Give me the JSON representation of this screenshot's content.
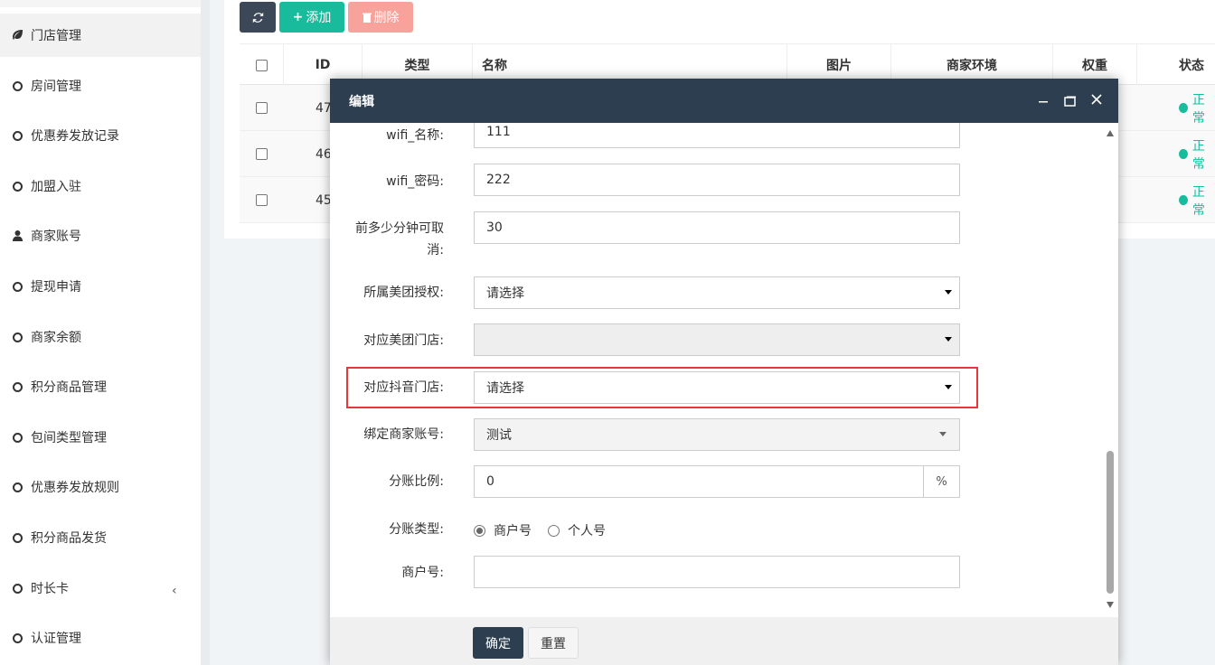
{
  "sidebar": {
    "items": [
      {
        "label": "门店管理",
        "icon": "leaf-icon"
      },
      {
        "label": "房间管理",
        "icon": "circle-icon"
      },
      {
        "label": "优惠券发放记录",
        "icon": "circle-icon"
      },
      {
        "label": "加盟入驻",
        "icon": "circle-icon"
      },
      {
        "label": "商家账号",
        "icon": "user-icon"
      },
      {
        "label": "提现申请",
        "icon": "circle-icon"
      },
      {
        "label": "商家余额",
        "icon": "circle-icon"
      },
      {
        "label": "积分商品管理",
        "icon": "circle-icon"
      },
      {
        "label": "包间类型管理",
        "icon": "circle-icon"
      },
      {
        "label": "优惠券发放规则",
        "icon": "circle-icon"
      },
      {
        "label": "积分商品发货",
        "icon": "circle-icon"
      },
      {
        "label": "时长卡",
        "icon": "circle-icon"
      },
      {
        "label": "认证管理",
        "icon": "circle-icon"
      }
    ],
    "collapse_glyph": "‹"
  },
  "toolbar": {
    "add_label": "添加",
    "delete_label": "删除"
  },
  "table": {
    "headers": [
      "ID",
      "类型",
      "名称",
      "图片",
      "商家环境",
      "权重",
      "状态"
    ],
    "rows": [
      {
        "id": "47",
        "status": "正常"
      },
      {
        "id": "46",
        "status": "正常"
      },
      {
        "id": "45",
        "status": "正常"
      }
    ]
  },
  "modal": {
    "title": "编辑",
    "fields": {
      "wifi_name_label": "wifi_名称:",
      "wifi_name_value": "111",
      "wifi_pwd_label": "wifi_密码:",
      "wifi_pwd_value": "222",
      "cancel_label_line1": "前多少分钟可取",
      "cancel_label_line2": "消:",
      "cancel_value": "30",
      "meituan_auth_label": "所属美团授权:",
      "meituan_auth_value": "请选择",
      "meituan_store_label": "对应美团门店:",
      "meituan_store_value": "",
      "douyin_store_label": "对应抖音门店:",
      "douyin_store_value": "请选择",
      "merchant_account_label": "绑定商家账号:",
      "merchant_account_value": "测试",
      "split_ratio_label": "分账比例:",
      "split_ratio_value": "0",
      "split_ratio_unit": "%",
      "split_type_label": "分账类型:",
      "split_type_options": [
        "商户号",
        "个人号"
      ],
      "split_type_selected": "商户号",
      "merchant_no_label": "商户号:",
      "merchant_no_value": ""
    },
    "confirm_label": "确定",
    "reset_label": "重置"
  },
  "colors": {
    "primary_dark": "#2c3e50",
    "success": "#18bc9c",
    "danger_light": "#f7a29a",
    "highlight": "#e8373b"
  }
}
